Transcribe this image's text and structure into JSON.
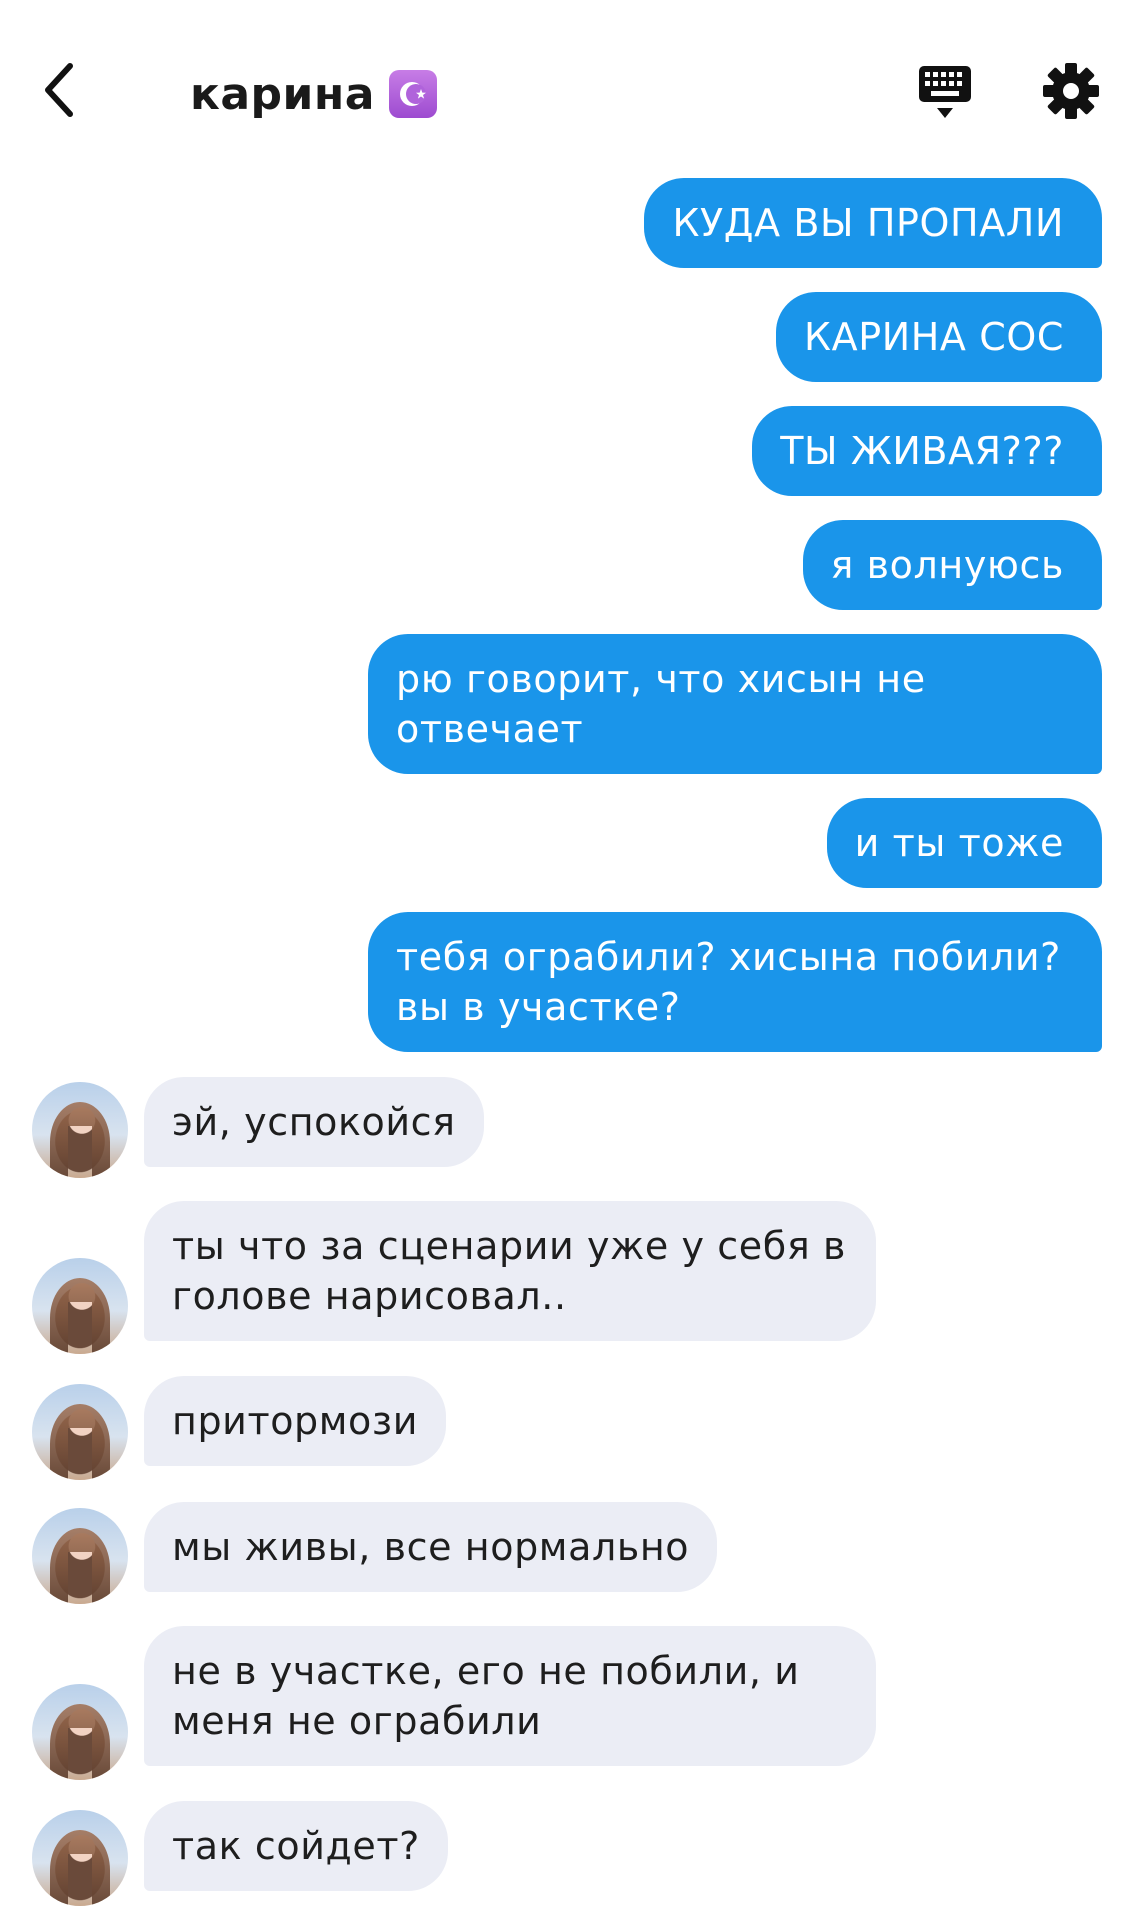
{
  "header": {
    "back_icon": "chevron-left-icon",
    "title": "карина",
    "title_emoji": "☪️",
    "keyboard_icon": "keyboard-icon",
    "settings_icon": "gear-icon"
  },
  "colors": {
    "outgoing_bubble": "#1a95ea",
    "incoming_bubble": "#ebedf5",
    "outgoing_text": "#ffffff",
    "incoming_text": "#1e1e1e"
  },
  "messages": [
    {
      "direction": "outgoing",
      "text": "КУДА ВЫ ПРОПАЛИ"
    },
    {
      "direction": "outgoing",
      "text": "КАРИНА СОС"
    },
    {
      "direction": "outgoing",
      "text": "ТЫ ЖИВАЯ???"
    },
    {
      "direction": "outgoing",
      "text": "я волнуюсь"
    },
    {
      "direction": "outgoing",
      "text": "рю говорит, что хисын не отвечает"
    },
    {
      "direction": "outgoing",
      "text": "и ты тоже"
    },
    {
      "direction": "outgoing",
      "text": "тебя ограбили? хисына побили? вы в участке?"
    },
    {
      "direction": "incoming",
      "text": "эй, успокойся"
    },
    {
      "direction": "incoming",
      "text": "ты что за сценарии уже у себя в голове нарисовал.."
    },
    {
      "direction": "incoming",
      "text": "притормози"
    },
    {
      "direction": "incoming",
      "text": "мы живы, все нормально"
    },
    {
      "direction": "incoming",
      "text": "не в участке, его не побили, и меня не ограбили"
    },
    {
      "direction": "incoming",
      "text": "так сойдет?"
    }
  ]
}
